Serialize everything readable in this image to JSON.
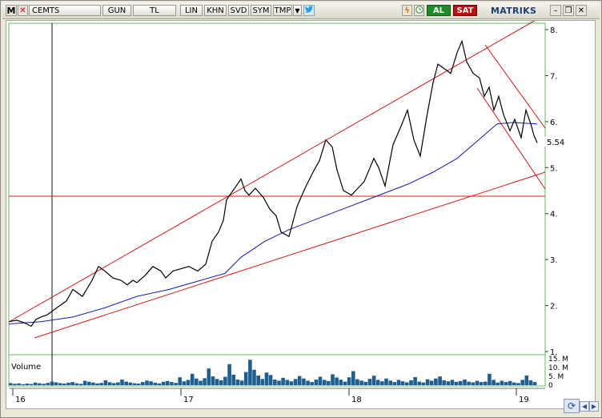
{
  "toolbar": {
    "menu_letter": "M",
    "symbol": "CEMTS",
    "buttons": [
      "GUN",
      "TL",
      "LIN",
      "KHN",
      "SVD",
      "SYM",
      "TMP"
    ],
    "al_label": "AL",
    "sat_label": "SAT",
    "brand": "MATRIKS",
    "twitter_icon": "twitter-icon",
    "bolt_icon": "lightning-icon",
    "clock_icon": "clock-icon"
  },
  "colors": {
    "price_line": "#000000",
    "moving_average": "#1a1aa8",
    "trend_lines": "#d21e1e",
    "volume_bars": "#1f5f8f",
    "grid_border": "#66bb66",
    "last_price_tag": "#ffffff"
  },
  "chart_data": {
    "type": "line",
    "symbol": "CEMTS",
    "period": "GUN",
    "y_ticks": [
      "8.",
      "7.",
      "6.",
      "5.",
      "4.",
      "3.",
      "2.",
      "1."
    ],
    "ylim": [
      1,
      8
    ],
    "last_price_label": "5.54",
    "x_ticks": [
      "16",
      "17",
      "18",
      "19"
    ],
    "volume_label": "Volume",
    "volume_ticks": [
      "15. M",
      "10. M",
      "5. M",
      "0"
    ],
    "series": [
      {
        "name": "",
        "x": [
          0,
          10,
          20,
          28,
          34,
          40,
          48,
          60,
          72,
          80,
          92,
          104,
          112,
          120,
          130,
          140,
          148,
          155,
          160,
          170,
          180,
          190,
          196,
          205,
          215,
          225,
          236,
          246,
          254,
          262,
          268,
          272,
          278,
          284,
          290,
          295,
          300,
          308,
          318,
          326,
          334,
          340,
          350,
          360,
          370,
          380,
          388,
          396,
          404,
          410,
          418,
          428,
          436,
          444,
          450,
          456,
          462,
          470,
          480,
          490,
          498,
          506,
          514,
          522,
          530,
          536,
          544,
          552,
          560,
          566,
          572,
          580,
          588,
          594,
          600,
          606,
          612,
          618,
          626,
          632,
          640,
          646,
          652,
          656,
          660
        ],
        "values": [
          1.65,
          1.68,
          1.62,
          1.55,
          1.7,
          1.75,
          1.8,
          1.95,
          2.1,
          2.35,
          2.2,
          2.55,
          2.85,
          2.75,
          2.6,
          2.55,
          2.45,
          2.55,
          2.5,
          2.65,
          2.85,
          2.75,
          2.6,
          2.75,
          2.8,
          2.85,
          2.75,
          2.9,
          3.4,
          3.6,
          3.85,
          4.3,
          4.45,
          4.6,
          4.75,
          4.5,
          4.4,
          4.55,
          4.35,
          4.1,
          3.95,
          3.6,
          3.5,
          4.15,
          4.55,
          4.9,
          5.15,
          5.6,
          5.45,
          4.95,
          4.5,
          4.4,
          4.55,
          4.7,
          4.95,
          5.2,
          5.0,
          4.6,
          5.5,
          5.9,
          6.25,
          5.6,
          5.25,
          6.1,
          6.85,
          7.25,
          7.15,
          7.05,
          7.5,
          7.75,
          7.3,
          7.05,
          6.95,
          6.55,
          6.75,
          6.25,
          6.55,
          6.15,
          5.8,
          6.05,
          5.65,
          6.25,
          5.95,
          5.7,
          5.54
        ]
      },
      {
        "name": "",
        "x": [
          0,
          40,
          80,
          120,
          160,
          200,
          240,
          270,
          290,
          320,
          350,
          380,
          410,
          440,
          470,
          500,
          530,
          560,
          590,
          610,
          630,
          660
        ],
        "values": [
          1.6,
          1.65,
          1.75,
          1.95,
          2.2,
          2.35,
          2.55,
          2.7,
          3.05,
          3.4,
          3.65,
          3.85,
          4.05,
          4.25,
          4.45,
          4.65,
          4.9,
          5.2,
          5.65,
          5.95,
          5.98,
          5.95
        ]
      }
    ],
    "volume_values": [
      1.2,
      0.8,
      1.0,
      0.6,
      0.9,
      0.7,
      1.5,
      1.1,
      0.8,
      1.3,
      2.0,
      1.6,
      1.2,
      0.9,
      1.4,
      1.8,
      1.1,
      0.8,
      2.5,
      1.9,
      1.5,
      1.0,
      1.3,
      2.8,
      1.7,
      1.2,
      1.6,
      3.2,
      2.0,
      1.5,
      1.1,
      0.9,
      1.8,
      2.6,
      2.2,
      1.4,
      1.0,
      1.9,
      2.4,
      1.8,
      1.3,
      4.5,
      2.2,
      3.0,
      6.5,
      3.8,
      2.5,
      4.0,
      9.5,
      5.0,
      3.5,
      2.8,
      4.8,
      12.0,
      6.0,
      3.2,
      2.6,
      7.5,
      14.5,
      8.8,
      5.5,
      3.5,
      7.2,
      5.8,
      3.2,
      2.5,
      4.2,
      3.0,
      2.2,
      3.5,
      5.2,
      3.8,
      2.5,
      1.8,
      3.2,
      4.8,
      3.0,
      2.4,
      6.2,
      4.4,
      3.1,
      2.0,
      4.5,
      8.0,
      3.4,
      2.6,
      1.9,
      3.6,
      5.4,
      3.0,
      2.2,
      3.8,
      2.6,
      1.8,
      3.0,
      2.2,
      1.6,
      2.8,
      4.6,
      2.0,
      1.5,
      3.4,
      2.5,
      3.8,
      5.0,
      2.8,
      2.2,
      3.0,
      1.9,
      2.4,
      3.2,
      2.0,
      1.6,
      2.5,
      1.8,
      2.0,
      6.5,
      3.0,
      1.5,
      2.5,
      1.8,
      2.4,
      1.5,
      1.2,
      3.0,
      5.5,
      2.8,
      1.8
    ]
  }
}
